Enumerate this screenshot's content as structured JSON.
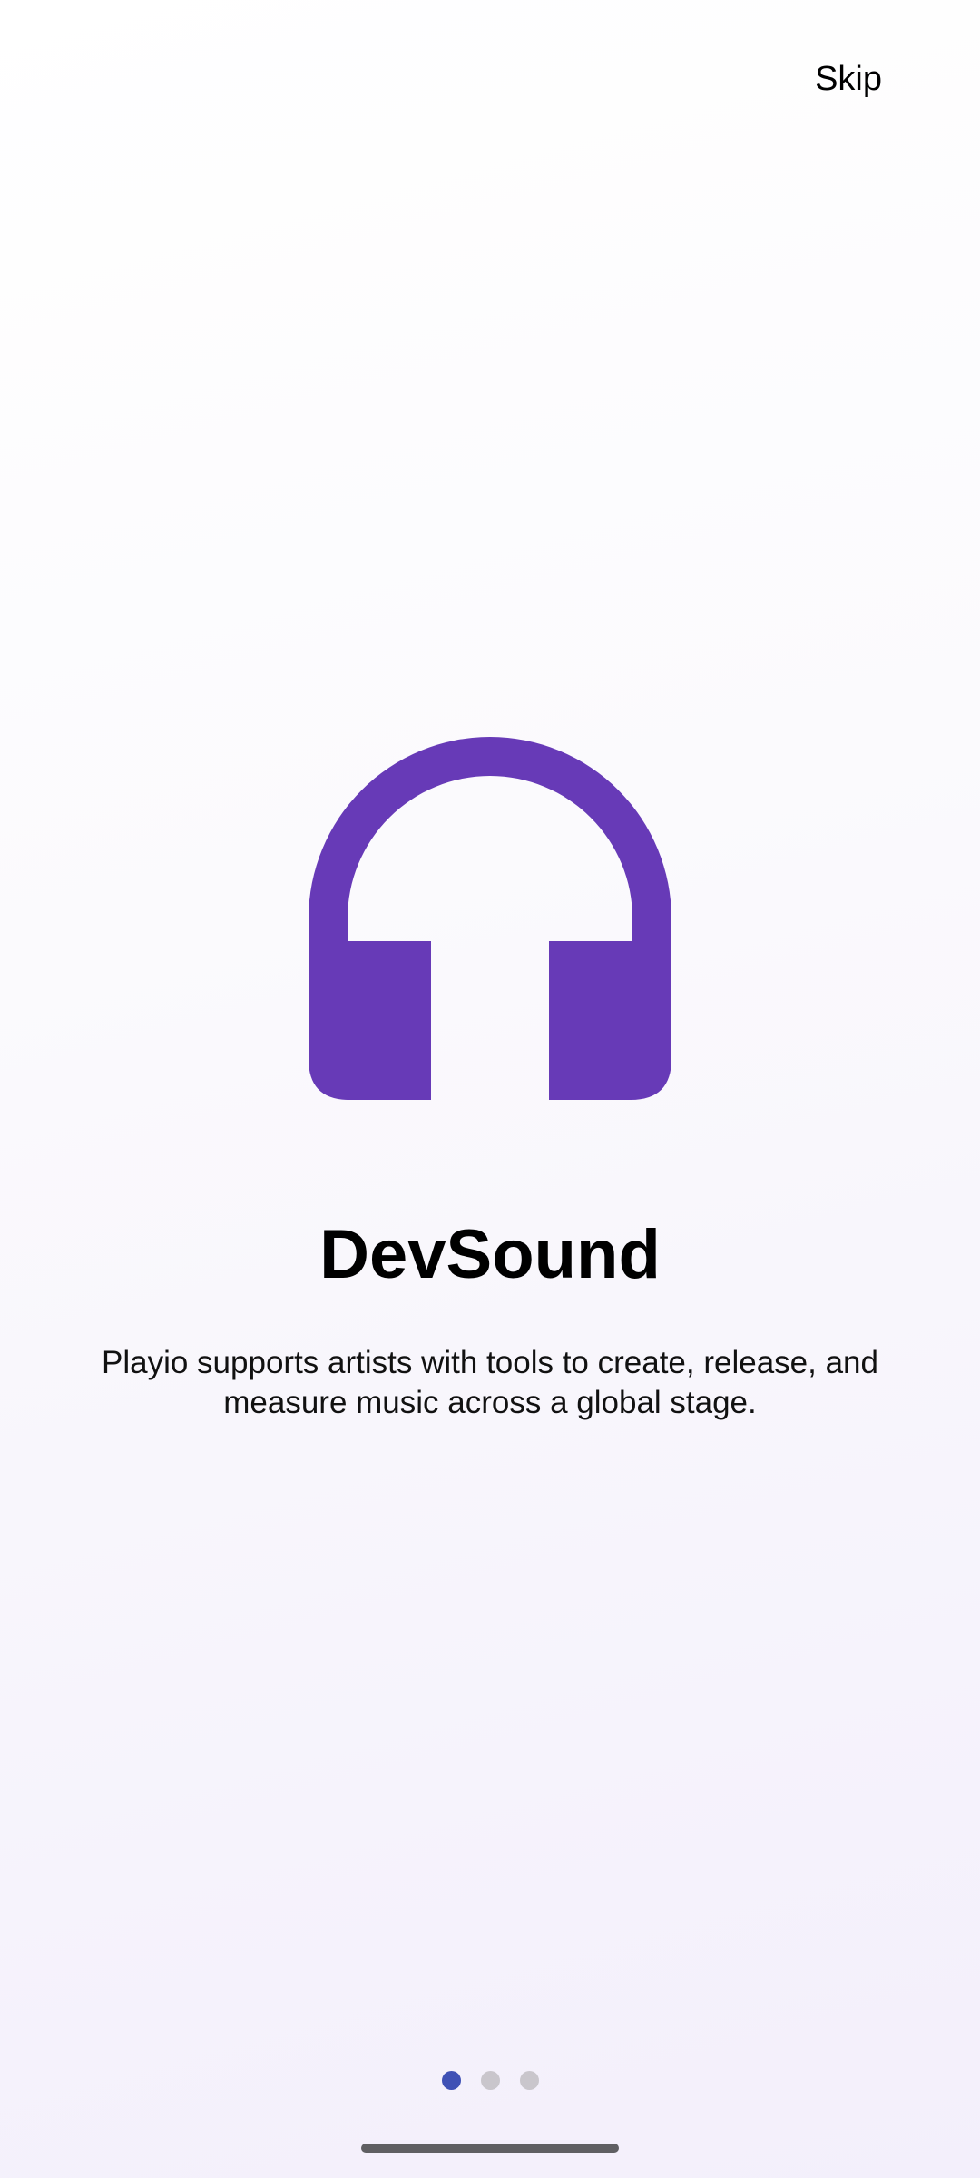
{
  "header": {
    "skip_label": "Skip"
  },
  "hero": {
    "icon": "headphones-icon",
    "icon_color": "#673ab7"
  },
  "content": {
    "title": "DevSound",
    "description": "Playio supports artists with tools to create, release, and measure music across a global stage."
  },
  "pager": {
    "page_count": 3,
    "current_page": 1,
    "active_color": "#3f51b5",
    "inactive_color": "#c9c6cc"
  },
  "system": {
    "home_indicator_color": "#5f5f62"
  }
}
